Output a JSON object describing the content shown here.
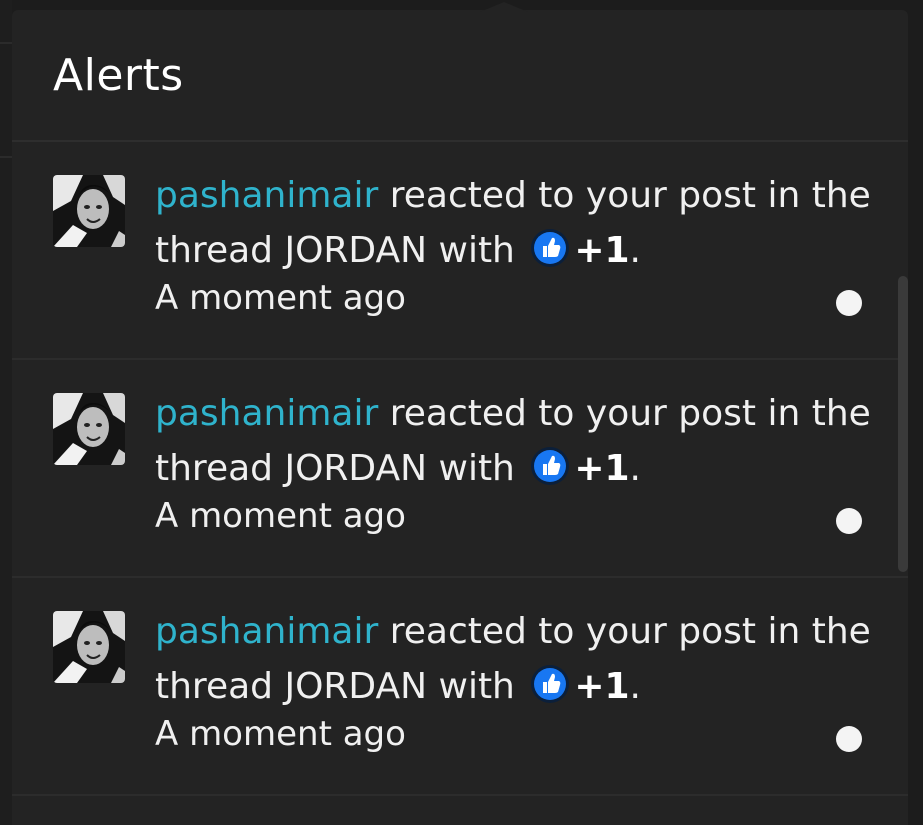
{
  "popup": {
    "title": "Alerts"
  },
  "alerts": [
    {
      "username": "pashanimair",
      "text_before": " reacted to your post in the thread JORDAN with ",
      "reaction_icon": "thumbs-up-icon",
      "reaction": "+1",
      "text_after": ".",
      "time": "A moment ago",
      "unread": true
    },
    {
      "username": "pashanimair",
      "text_before": " reacted to your post in the thread JORDAN with ",
      "reaction_icon": "thumbs-up-icon",
      "reaction": "+1",
      "text_after": ".",
      "time": "A moment ago",
      "unread": true
    },
    {
      "username": "pashanimair",
      "text_before": " reacted to your post in the thread JORDAN with ",
      "reaction_icon": "thumbs-up-icon",
      "reaction": "+1",
      "text_after": ".",
      "time": "A moment ago",
      "unread": true
    }
  ],
  "colors": {
    "accent": "#2fb3cc",
    "popup_background": "#232323",
    "reaction_blue": "#1877f2"
  }
}
